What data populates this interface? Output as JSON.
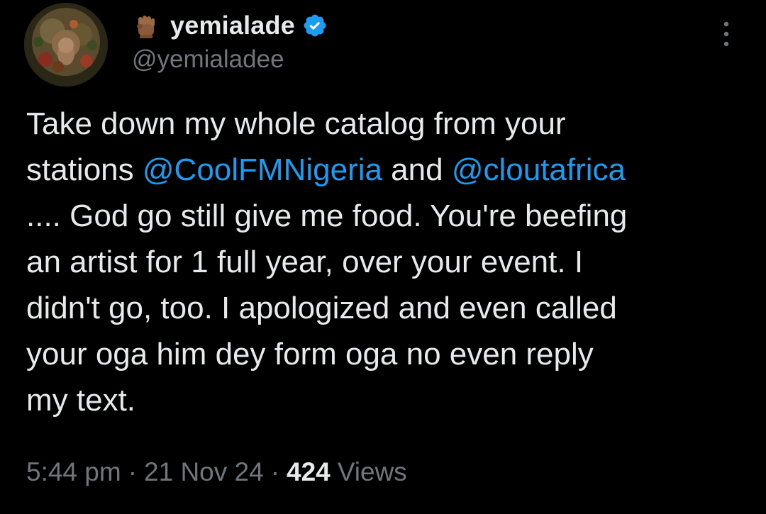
{
  "author": {
    "display_name": "yemialade",
    "handle": "@yemialadee",
    "verified": true,
    "badge_icon": "raised-fist-icon",
    "verified_icon": "verified-badge-icon"
  },
  "menu": {
    "icon": "more-options-icon"
  },
  "tweet": {
    "lines": [
      [
        {
          "text": "Take down my whole catalog from your",
          "type": "text"
        }
      ],
      [
        {
          "text": "stations ",
          "type": "text"
        },
        {
          "text": "@CoolFMNigeria",
          "type": "mention"
        },
        {
          "text": " and ",
          "type": "text"
        },
        {
          "text": "@cloutafrica",
          "type": "mention"
        }
      ],
      [
        {
          "text": ".... God go still give me food. You're beefing",
          "type": "text"
        }
      ],
      [
        {
          "text": "an artist for 1 full year, over your event. I",
          "type": "text"
        }
      ],
      [
        {
          "text": "didn't go, too. I apologized and even called",
          "type": "text"
        }
      ],
      [
        {
          "text": "your oga him dey form oga no even reply",
          "type": "text"
        }
      ],
      [
        {
          "text": "my text.",
          "type": "text"
        }
      ]
    ]
  },
  "meta": {
    "time": "5:44 pm",
    "separator": "·",
    "date": "21 Nov 24",
    "views_count": "424",
    "views_label": "Views"
  },
  "colors": {
    "background": "#000000",
    "text": "#e7e9ea",
    "secondary": "#71767b",
    "accent": "#1d9bf0"
  }
}
